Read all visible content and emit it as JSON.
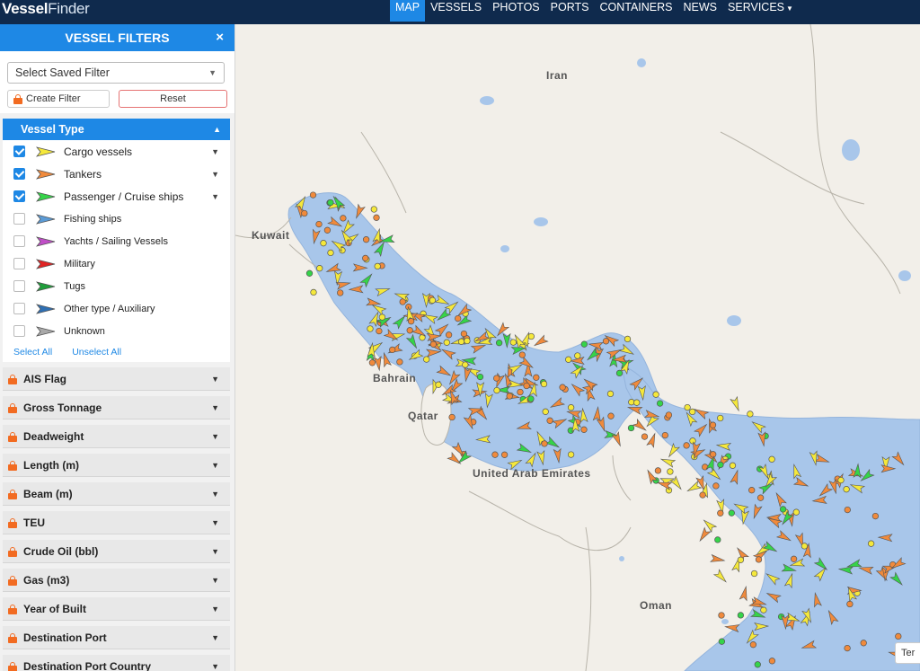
{
  "app": {
    "logo_vessel": "Vessel",
    "logo_finder": "Finder"
  },
  "nav": {
    "items": [
      "MAP",
      "VESSELS",
      "PHOTOS",
      "PORTS",
      "CONTAINERS",
      "NEWS",
      "SERVICES"
    ],
    "active": "MAP"
  },
  "sidebar": {
    "title": "VESSEL FILTERS",
    "close_icon": "×",
    "saved_filter_placeholder": "Select Saved Filter",
    "create_filter_label": "Create Filter",
    "reset_label": "Reset",
    "vessel_type": {
      "header": "Vessel Type",
      "items": [
        {
          "label": "Cargo vessels",
          "checked": true,
          "color": "#f5e83b",
          "has_dropdown": true
        },
        {
          "label": "Tankers",
          "checked": true,
          "color": "#f08a3c",
          "has_dropdown": true
        },
        {
          "label": "Passenger / Cruise ships",
          "checked": true,
          "color": "#35d449",
          "has_dropdown": true
        },
        {
          "label": "Fishing ships",
          "checked": false,
          "color": "#5b9bd6",
          "has_dropdown": false
        },
        {
          "label": "Yachts / Sailing Vessels",
          "checked": false,
          "color": "#c04ec7",
          "has_dropdown": false
        },
        {
          "label": "Military",
          "checked": false,
          "color": "#e02424",
          "has_dropdown": false
        },
        {
          "label": "Tugs",
          "checked": false,
          "color": "#1f9e3a",
          "has_dropdown": false
        },
        {
          "label": "Other type / Auxiliary",
          "checked": false,
          "color": "#2f6fb3",
          "has_dropdown": false
        },
        {
          "label": "Unknown",
          "checked": false,
          "color": "#a9a9a9",
          "has_dropdown": false
        }
      ],
      "select_all": "Select All",
      "unselect_all": "Unselect All"
    },
    "accordions": [
      "AIS Flag",
      "Gross Tonnage",
      "Deadweight",
      "Length (m)",
      "Beam (m)",
      "TEU",
      "Crude Oil (bbl)",
      "Gas (m3)",
      "Year of Built",
      "Destination Port",
      "Destination Port Country"
    ]
  },
  "map": {
    "labels": {
      "iran": "Iran",
      "kuwait": "Kuwait",
      "bahrain": "Bahrain",
      "qatar": "Qatar",
      "uae": "United Arab Emirates",
      "oman": "Oman"
    },
    "corner_button": "Ter",
    "colors": {
      "land": "#f2efe9",
      "water": "#a8c6ea",
      "border": "#b8b4aa",
      "accent": "#1e88e5",
      "nav_bg": "#0f2a4d"
    }
  }
}
